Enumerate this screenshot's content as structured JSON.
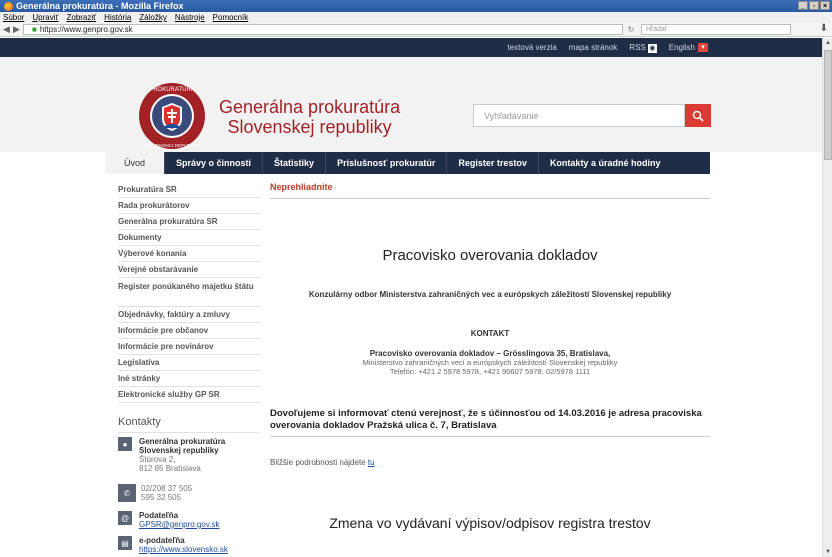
{
  "window": {
    "title": "Generálna prokuratúra - Mozilla Firefox",
    "controls": [
      "_",
      "▫",
      "×"
    ]
  },
  "menu": [
    "Súbor",
    "Upraviť",
    "Zobraziť",
    "História",
    "Záložky",
    "Nástroje",
    "Pomocník"
  ],
  "browser": {
    "url": "https://www.genpro.gov.sk",
    "search_placeholder": "Hľadať"
  },
  "topbar": {
    "links": [
      "textová verzia",
      "mapa stránok"
    ],
    "rss": "RSS",
    "lang": "English"
  },
  "header": {
    "title_line1": "Generálna prokuratúra",
    "title_line2": "Slovenskej republiky",
    "emblem_text_top": "PROKURATÚRA",
    "emblem_text_bottom": "SLOVENSKEJ REPUBLIKY",
    "search_placeholder": "Vyhľadávanie"
  },
  "nav": [
    "Úvod",
    "Správy o činnosti",
    "Štatistiky",
    "Príslušnosť prokuratúr",
    "Register trestov",
    "Kontakty a úradné hodiny"
  ],
  "sidebar": [
    "Prokuratúra SR",
    "Rada prokurátorov",
    "Generálna prokuratúra SR",
    "Dokumenty",
    "Výberové konania",
    "Verejné obstarávanie",
    "Register ponúkaného majetku štátu",
    "Objednávky, faktúry a zmluvy",
    "Informácie pre občanov",
    "Informácie pre novinárov",
    "Legislatíva",
    "Iné stránky",
    "Elektronické služby GP SR"
  ],
  "contacts": {
    "title": "Kontakty",
    "org_line1": "Generálna prokuratúra",
    "org_line2": "Slovenskej republiky",
    "street": "Štúrova 2,",
    "city": "812 85 Bratislava",
    "phone1": "02/208 37 505",
    "phone2": "595 32 505",
    "podatelna_label": "Podateľňa",
    "podatelna_email": "GPSR@genpro.gov.sk",
    "epodatelna_label": "e-podateľňa",
    "epodatelna_url": "https://www.slovensko.sk"
  },
  "content": {
    "section": "Neprehliadnite",
    "heading": "Pracovisko overovania dokladov",
    "konzularny": "Konzulárny odbor Ministerstva zahraničných vec a európskych záležitostí Slovenskej republiky",
    "kontakt": "KONTAKT",
    "addr_line1": "Pracovisko overovania dokladov – Grösslingova 35, Bratislava,",
    "addr_line2": "Ministerstvo zahraničných vecí a európskych záležitostí Slovenskej republiky",
    "addr_line3": "Telefón: +421 2 5978 5978, +421 90607 5978, 02/5978 1111",
    "dovolujeme": "Dovoľujeme si informovať ctenú verejnosť, že s účinnosťou od 14.03.2016 je adresa pracoviska overovania dokladov Pražská ulica č. 7, Bratislava",
    "blizsie_prefix": "Bližšie podrobnosti nájdete ",
    "blizsie_link": "tu",
    "zmena": "Zmena vo vydávaní výpisov/odpisov registra trestov"
  }
}
